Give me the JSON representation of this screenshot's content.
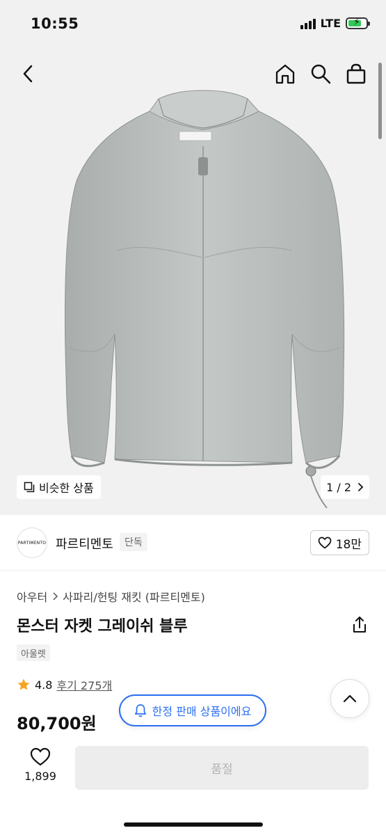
{
  "status_bar": {
    "time": "10:55",
    "network": "LTE"
  },
  "gallery": {
    "similar_label": "비슷한 상품",
    "page_indicator": "1 / 2"
  },
  "brand": {
    "logo_text": "PARTIMENTO",
    "name": "파르티멘토",
    "badge": "단독",
    "likes": "18만"
  },
  "breadcrumb": {
    "category": "아우터",
    "subcategory": "사파리/헌팅 재킷 (파르티멘토)"
  },
  "product": {
    "title": "몬스터 자켓 그레이쉬 블루",
    "tag": "아울렛",
    "rating": "4.8",
    "reviews": "후기 275개",
    "price": "80,700원"
  },
  "notice": {
    "limited_label": "한정 판매 상품이에요"
  },
  "bottom_bar": {
    "wish_count": "1,899",
    "soldout_label": "품절"
  },
  "colors": {
    "accent": "#2a6ff2",
    "star": "#f5a623",
    "jacket": "#b7bcba",
    "background": "#f1f1f1"
  },
  "icons": [
    "back-arrow-icon",
    "home-icon",
    "search-icon",
    "bag-icon",
    "similar-icon",
    "chevron-right-icon",
    "heart-icon",
    "share-icon",
    "star-icon",
    "bell-icon",
    "chevron-up-icon"
  ]
}
